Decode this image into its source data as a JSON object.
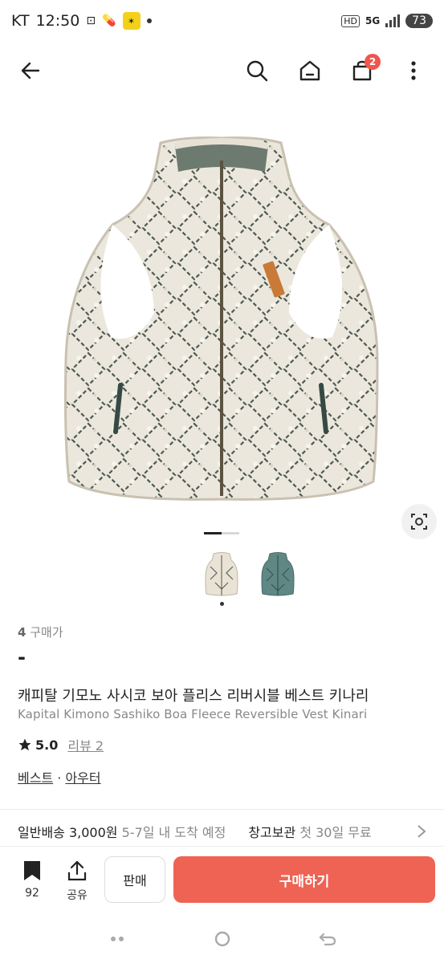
{
  "status": {
    "carrier": "KT",
    "time": "12:50",
    "hd": "HD",
    "network": "5G",
    "battery": "73"
  },
  "nav": {
    "cart_count": "2",
    "icons": [
      "back-arrow-icon",
      "search-icon",
      "home-icon",
      "shopping-bag-icon",
      "more-vertical-icon"
    ]
  },
  "product": {
    "price_count": "4",
    "price_label": "구매가",
    "price_value": "-",
    "title_ko": "캐피탈 기모노 사시코 보아 플리스 리버시블 베스트 키나리",
    "title_en": "Kapital Kimono Sashiko Boa Fleece Reversible Vest Kinari",
    "rating": "5.0",
    "review_label": "리뷰 2",
    "category_main": "베스트",
    "category_sep": " · ",
    "category_sub": "아우터"
  },
  "shipping": {
    "label": "일반배송",
    "fee": "3,000원",
    "eta": "5-7일 내 도착 예정",
    "storage_label": "창고보관",
    "storage_note": "첫 30일 무료"
  },
  "bottom": {
    "favorite_count": "92",
    "share_label": "공유",
    "sell_label": "판매",
    "buy_label": "구매하기"
  },
  "colors": {
    "accent": "#ee6354",
    "badge": "#f0564b"
  }
}
